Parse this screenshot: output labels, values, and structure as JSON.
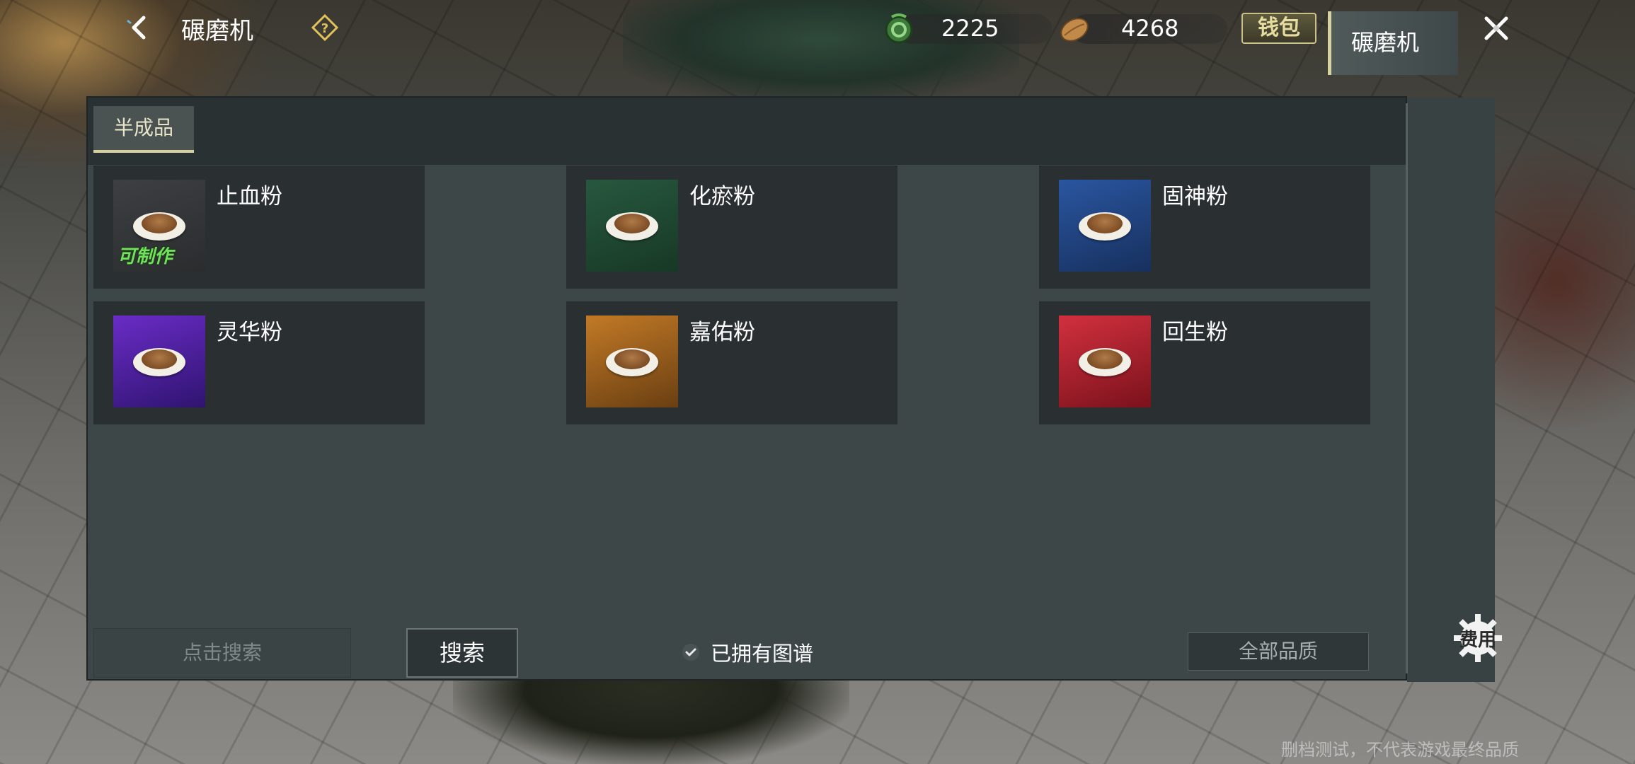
{
  "header": {
    "title": "碾磨机",
    "back_icon": "chevron-left-icon",
    "help_icon": "question-diamond-icon",
    "currencies": [
      {
        "icon": "green-coin-icon",
        "amount": "2225"
      },
      {
        "icon": "bean-token-icon",
        "amount": "4268"
      }
    ],
    "wallet_label": "钱包",
    "close_icon": "close-x-icon"
  },
  "tabs": [
    {
      "label": "半成品",
      "active": true
    }
  ],
  "items": [
    {
      "name": "止血粉",
      "thumb_color": "#2f3234",
      "craftable": true,
      "craftable_label": "可制作"
    },
    {
      "name": "化瘀粉",
      "thumb_color": "#1f4a33",
      "craftable": false
    },
    {
      "name": "固神粉",
      "thumb_color": "#1e4178",
      "craftable": false
    },
    {
      "name": "灵华粉",
      "thumb_color": "#4b1f9a",
      "craftable": false
    },
    {
      "name": "嘉佑粉",
      "thumb_color": "#9a5a1b",
      "craftable": false
    },
    {
      "name": "回生粉",
      "thumb_color": "#b01e2e",
      "craftable": false
    }
  ],
  "search": {
    "placeholder": "点击搜索",
    "button_label": "搜索"
  },
  "owned_filter": {
    "label": "已拥有图谱",
    "checked": true
  },
  "quality_select": {
    "value": "全部品质"
  },
  "side": {
    "tab_label": "碾磨机",
    "cost_label": "费用"
  },
  "watermark": "删档测试，不代表游戏最终品质",
  "colors": {
    "accent": "#d5d0a0",
    "panel": "#3d4748",
    "craftable_green": "#6ee35a"
  }
}
